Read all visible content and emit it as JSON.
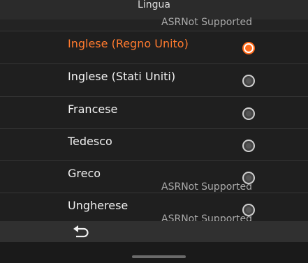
{
  "title": "Lingua",
  "asr_note": "ASRNot Supported",
  "options": [
    {
      "label": "Inglese (Regno Unito)",
      "selected": true
    },
    {
      "label": "Inglese (Stati Uniti)",
      "selected": false
    },
    {
      "label": "Francese",
      "selected": false
    },
    {
      "label": "Tedesco",
      "selected": false
    },
    {
      "label": "Greco",
      "selected": false
    },
    {
      "label": "Ungherese",
      "selected": false
    }
  ],
  "colors": {
    "accent": "#ff6a1a",
    "background": "#1f1f1f"
  },
  "icons": {
    "back": "back-arrow-icon"
  }
}
